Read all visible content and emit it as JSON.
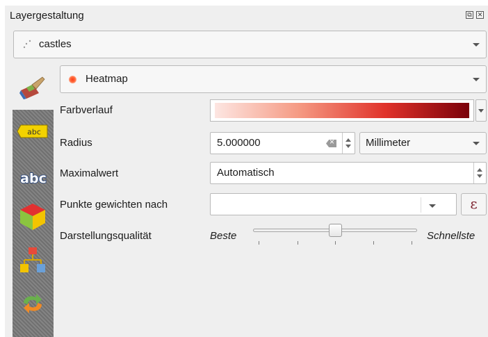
{
  "panel": {
    "title": "Layergestaltung",
    "float_icon": "float-icon",
    "close_icon": "close-icon"
  },
  "layer_select": {
    "value": "castles",
    "icon": "point-layer-icon"
  },
  "renderer_select": {
    "value": "Heatmap",
    "icon": "heatmap-dot-icon"
  },
  "sidebar": {
    "items": [
      {
        "name": "symbology",
        "icon": "paintbrush-icon"
      },
      {
        "name": "labels",
        "icon": "label-abc-yellow-icon"
      },
      {
        "name": "masks",
        "icon": "label-abc-outline-icon"
      },
      {
        "name": "3d-view",
        "icon": "cube-3d-icon"
      },
      {
        "name": "diagrams",
        "icon": "diagram-icon"
      },
      {
        "name": "history",
        "icon": "undo-redo-icon"
      }
    ]
  },
  "form": {
    "color_ramp": {
      "label": "Farbverlauf",
      "colors": [
        "#fde6e2",
        "#f59a83",
        "#e0322a",
        "#7a0009"
      ]
    },
    "radius": {
      "label": "Radius",
      "value": "5.000000",
      "unit": "Millimeter"
    },
    "max_value": {
      "label": "Maximalwert",
      "value": "Automatisch"
    },
    "weight": {
      "label": "Punkte gewichten nach",
      "value": "",
      "expr_symbol": "ε"
    },
    "quality": {
      "label": "Darstellungsqualität",
      "min_label": "Beste",
      "max_label": "Schnellste",
      "position": 0.5
    }
  }
}
